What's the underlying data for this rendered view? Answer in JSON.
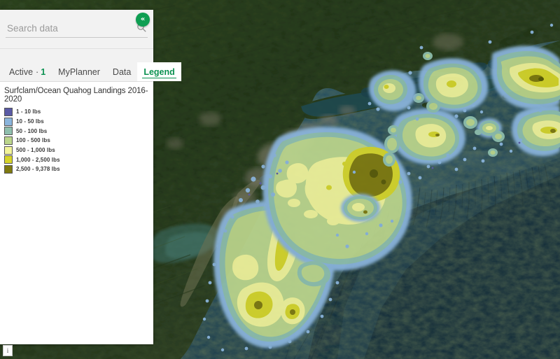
{
  "search": {
    "placeholder": "Search data",
    "value": "",
    "icon": "search-icon"
  },
  "collapse_button": {
    "label": "«",
    "icon": "double-chevron-left-icon",
    "color": "#0e9e52"
  },
  "info_button": {
    "label": "i",
    "icon": "info-icon"
  },
  "tabs": [
    {
      "label": "Active",
      "separator": "·",
      "count": "1",
      "active": false
    },
    {
      "label": "MyPlanner",
      "active": false
    },
    {
      "label": "Data",
      "active": false
    },
    {
      "label": "Legend",
      "active": true
    }
  ],
  "legend": {
    "title": "Surfclam/Ocean Quahog Landings 2016-2020",
    "items": [
      {
        "label": "1 - 10 lbs",
        "color": "#5a5aa5"
      },
      {
        "label": "10 - 50 lbs",
        "color": "#8ab4dc"
      },
      {
        "label": "50 - 100 lbs",
        "color": "#8fbfae"
      },
      {
        "label": "100 - 500 lbs",
        "color": "#bcd68c"
      },
      {
        "label": "500 - 1,000 lbs",
        "color": "#f2f49a"
      },
      {
        "label": "1,000 - 2,500 lbs",
        "color": "#d7d52a"
      },
      {
        "label": "2,500 - 9,378 lbs",
        "color": "#7f7a10"
      }
    ]
  },
  "map": {
    "type": "satellite-basemap-with-heatmap",
    "ocean_shallow": "#2b5a73",
    "ocean_deep": "#1b3a4c",
    "land": "#2e4423",
    "urban": "#8e8878",
    "heat_colors": {
      "b1": "#5a5aa5",
      "b2": "#8ab4dc",
      "b3": "#8fbfae",
      "b4": "#bcd68c",
      "b5": "#f2f49a",
      "b6": "#d7d52a",
      "b7": "#7f7a10"
    }
  }
}
